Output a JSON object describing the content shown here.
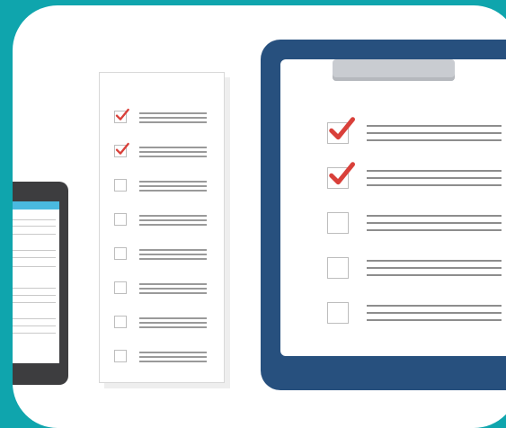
{
  "colors": {
    "background": "#0fa5ad",
    "card": "#ffffff",
    "clipboard": "#27507e",
    "check": "#d9403a",
    "checkbox_border": "#bdbdbd",
    "lines": "#9a9a9a",
    "tablet": "#3d3d3f",
    "tablet_header": "#4ab9df"
  },
  "paper_checklist": {
    "items": [
      {
        "checked": true
      },
      {
        "checked": true
      },
      {
        "checked": false
      },
      {
        "checked": false
      },
      {
        "checked": false
      },
      {
        "checked": false
      },
      {
        "checked": false
      },
      {
        "checked": false
      }
    ]
  },
  "clipboard_checklist": {
    "items": [
      {
        "checked": true
      },
      {
        "checked": true
      },
      {
        "checked": false
      },
      {
        "checked": false
      },
      {
        "checked": false
      }
    ]
  }
}
